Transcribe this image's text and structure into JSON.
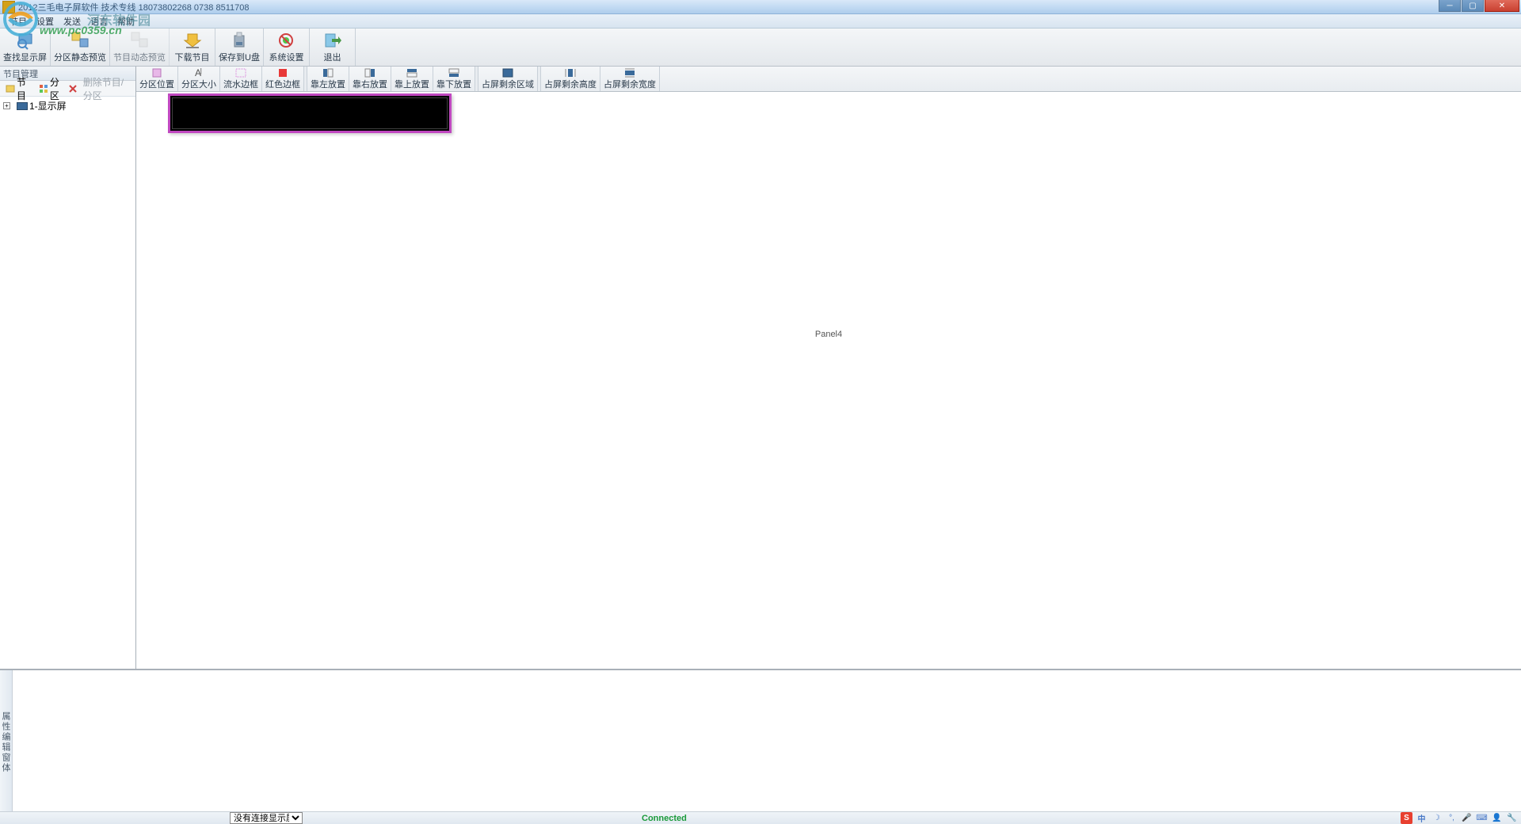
{
  "window": {
    "title": "2012三毛电子屏软件 技术专线 18073802268  0738 8511708"
  },
  "watermark": {
    "url": "www.pc0359.cn",
    "site": "河东软件园"
  },
  "menu": {
    "items": [
      "节目",
      "设置",
      "发送",
      "语言",
      "帮助"
    ]
  },
  "toolbar": {
    "items": [
      {
        "label": "查找显示屏",
        "icon": "search-screen"
      },
      {
        "label": "分区静态预览",
        "icon": "preview-static"
      },
      {
        "label": "节目动态预览",
        "icon": "preview-dynamic",
        "disabled": true
      },
      {
        "label": "下载节目",
        "icon": "download"
      },
      {
        "label": "保存到U盘",
        "icon": "save-usb"
      },
      {
        "label": "系统设置",
        "icon": "settings"
      },
      {
        "label": "退出",
        "icon": "exit"
      }
    ]
  },
  "leftPanel": {
    "title": "节目管理",
    "buttons": {
      "addProgram": "节目",
      "addArea": "分区",
      "delete": "删除节目/分区"
    },
    "tree": {
      "root": "1-显示屏"
    }
  },
  "subToolbar": {
    "items": [
      {
        "label": "分区位置",
        "icon": "pos"
      },
      {
        "label": "分区大小",
        "icon": "size"
      },
      {
        "label": "流水边框",
        "icon": "border-flow"
      },
      {
        "label": "红色边框",
        "icon": "border-red"
      },
      {
        "label": "靠左放置",
        "icon": "align-l"
      },
      {
        "label": "靠右放置",
        "icon": "align-r"
      },
      {
        "label": "靠上放置",
        "icon": "align-t"
      },
      {
        "label": "靠下放置",
        "icon": "align-b"
      },
      {
        "label": "占屏剩余区域",
        "icon": "fill-area"
      },
      {
        "label": "占屏剩余高度",
        "icon": "fill-h"
      },
      {
        "label": "占屏剩余宽度",
        "icon": "fill-w"
      }
    ]
  },
  "canvas": {
    "panelLabel": "Panel4"
  },
  "bottomPanel": {
    "title": "属性编辑窗体"
  },
  "statusbar": {
    "dropdown": "没有连接显示屏",
    "connected": "Connected"
  },
  "ime": {
    "lang": "中"
  }
}
